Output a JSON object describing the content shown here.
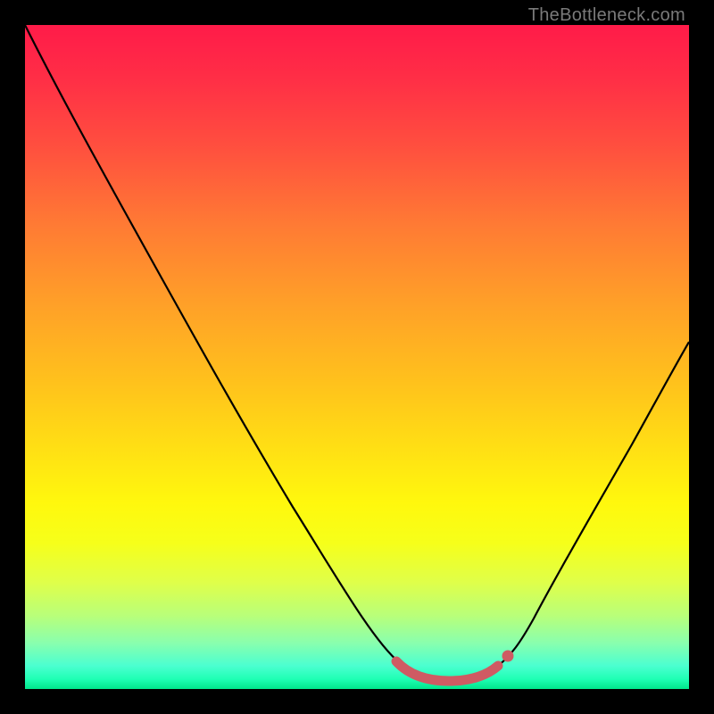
{
  "watermark": "TheBottleneck.com",
  "colors": {
    "frame": "#000000",
    "curve": "#000000",
    "valley_highlight": "#cf5b63",
    "gradient_top": "#ff1b49",
    "gradient_mid": "#ffe014",
    "gradient_bottom": "#00e58a"
  },
  "chart_data": {
    "type": "line",
    "title": "",
    "xlabel": "",
    "ylabel": "",
    "xlim": [
      0,
      100
    ],
    "ylim": [
      0,
      100
    ],
    "grid": false,
    "legend": false,
    "annotations": [
      "TheBottleneck.com"
    ],
    "series": [
      {
        "name": "bottleneck-curve",
        "x": [
          0,
          4,
          10,
          16,
          22,
          28,
          34,
          40,
          46,
          52,
          55,
          58,
          62,
          66,
          70,
          73,
          75,
          80,
          85,
          90,
          95,
          100
        ],
        "values": [
          100,
          92,
          82,
          72,
          62,
          52,
          42,
          32,
          22,
          12,
          6,
          3,
          2,
          2,
          3,
          6,
          10,
          20,
          31,
          42,
          53,
          64
        ]
      },
      {
        "name": "valley-highlight",
        "x": [
          55,
          58,
          62,
          66,
          70,
          73
        ],
        "values": [
          6,
          3,
          2,
          2,
          3,
          6
        ]
      }
    ]
  }
}
